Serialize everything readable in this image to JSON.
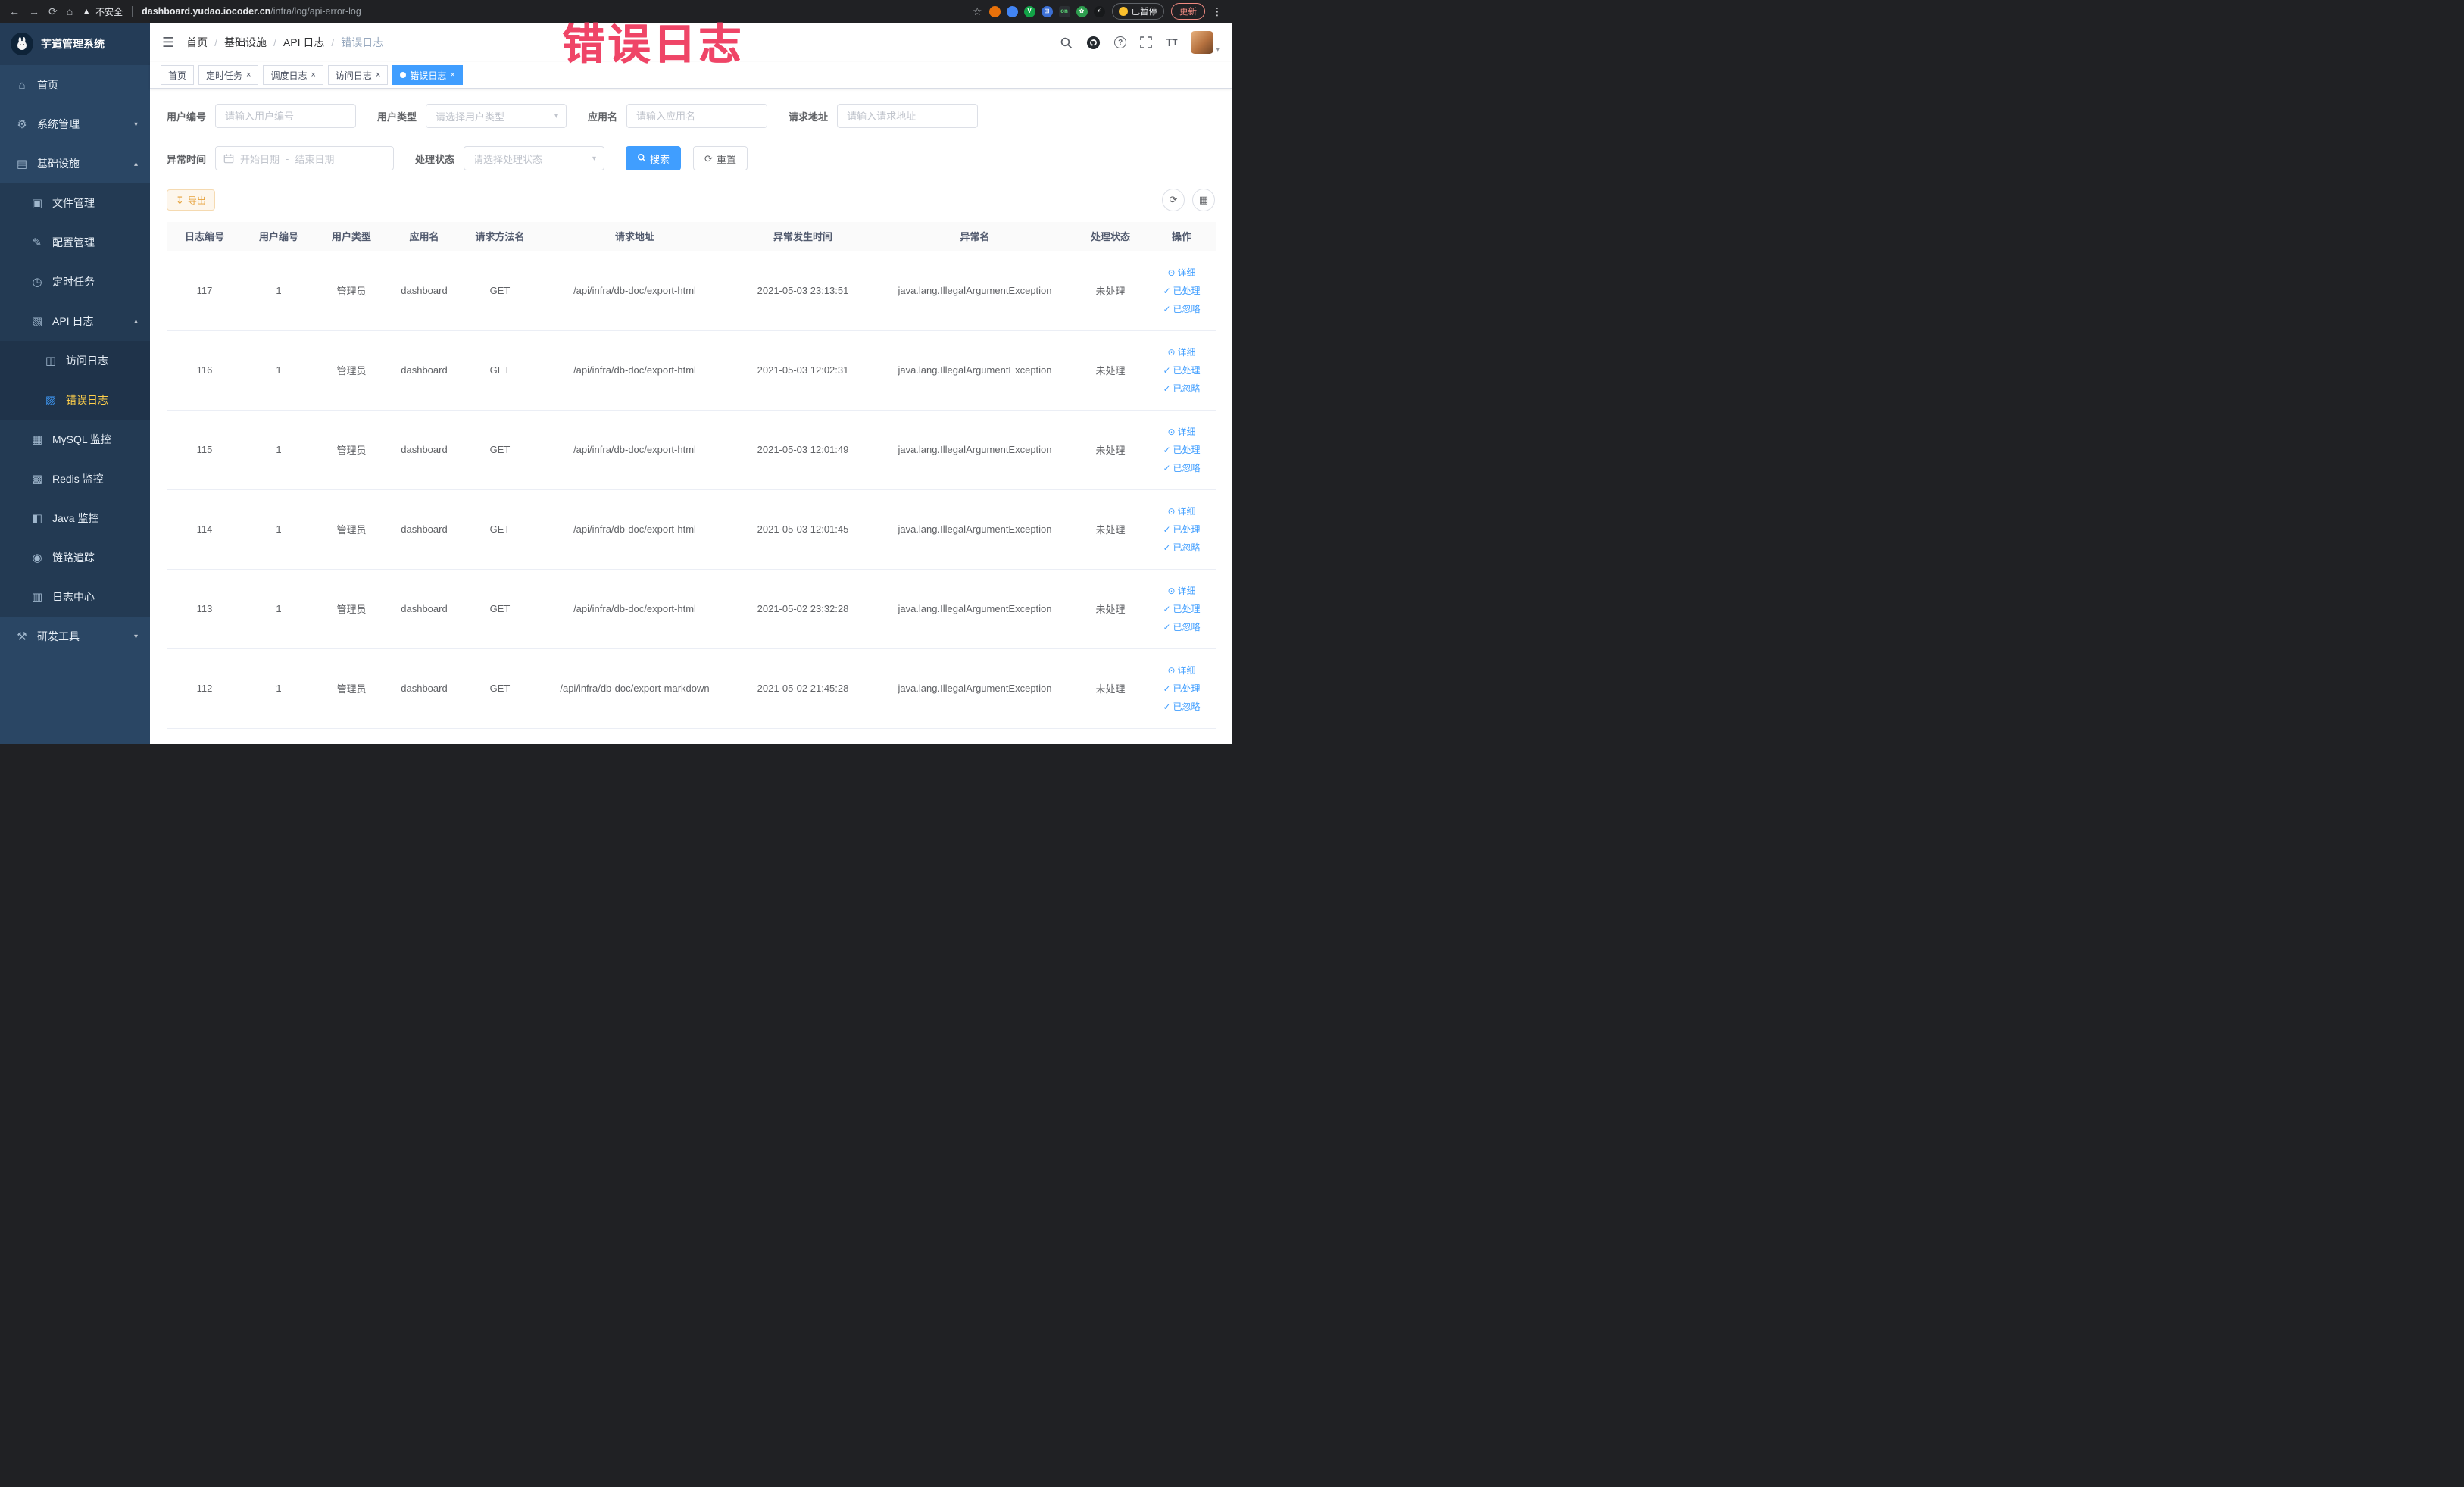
{
  "colors": {
    "accent": "#409eff",
    "sidebar_bg": "#2a4664",
    "menu_active_text": "#ffd04b",
    "annotation": "#ef4567",
    "warning": "#e6a23c",
    "tag_active_bg": "#409eff"
  },
  "annotation": {
    "text": "错误日志"
  },
  "browser": {
    "security_label": "不安全",
    "url_domain": "dashboard.yudao.iocoder.cn",
    "url_path": "/infra/log/api-error-log",
    "paused_badge": "已暂停",
    "update_button": "更新",
    "extensions": [
      {
        "name": "extension-red-icon",
        "bg": "#e8710a",
        "fg": "#ffffff",
        "glyph": "",
        "shape": "circle"
      },
      {
        "name": "extension-blue-dot-icon",
        "bg": "#4285f4",
        "fg": "#ffffff",
        "glyph": "",
        "shape": "circle"
      },
      {
        "name": "extension-green-v-icon",
        "bg": "#12a347",
        "fg": "#ffffff",
        "glyph": "V",
        "shape": "circle"
      },
      {
        "name": "extension-grid-icon",
        "bg": "#3b6fd4",
        "fg": "#ffffff",
        "glyph": "⊞",
        "shape": "circle"
      },
      {
        "name": "extension-on-badge-icon",
        "bg": "#2b2f33",
        "fg": "#58d274",
        "glyph": "on",
        "shape": "square"
      },
      {
        "name": "extension-leaf-icon",
        "bg": "#2e9e4f",
        "fg": "#ffffff",
        "glyph": "✿",
        "shape": "circle"
      },
      {
        "name": "extension-plug-icon",
        "bg": "#17191b",
        "fg": "#ffffff",
        "glyph": "⚡",
        "shape": "circle"
      }
    ]
  },
  "icons": {
    "search-icon": "magnifier",
    "github-icon": "octocat-circle",
    "help-icon": "question-circle",
    "fullscreen-icon": "expand-corners",
    "font-size-icon": "text-size",
    "hamburger-icon": "menu-lines",
    "back-icon": "arrow-left",
    "forward-icon": "arrow-right",
    "refresh-icon": "reload",
    "home-icon": "house",
    "bookmark-star-icon": "star-outline",
    "warning-triangle-icon": "warning",
    "calendar-icon": "calendar",
    "eye-icon": "view-detail",
    "check-icon": "checkmark"
  },
  "sidebar": {
    "logo_title": "芋道管理系统",
    "menu": [
      {
        "key": "home",
        "label": "首页",
        "glyph": "⌂",
        "icon": "home-icon",
        "level": 1
      },
      {
        "key": "system-management",
        "label": "系统管理",
        "glyph": "⚙",
        "icon": "gear-icon",
        "level": 1,
        "arrow": "down"
      },
      {
        "key": "infrastructure",
        "label": "基础设施",
        "glyph": "▤",
        "icon": "infrastructure-icon",
        "level": 1,
        "arrow": "up"
      },
      {
        "key": "file-management",
        "label": "文件管理",
        "glyph": "▣",
        "icon": "file-icon",
        "level": 2
      },
      {
        "key": "config-management",
        "label": "配置管理",
        "glyph": "✎",
        "icon": "config-icon",
        "level": 2
      },
      {
        "key": "scheduled-jobs",
        "label": "定时任务",
        "glyph": "◷",
        "icon": "timer-icon",
        "level": 2
      },
      {
        "key": "api-log",
        "label": "API 日志",
        "glyph": "▧",
        "icon": "api-log-icon",
        "level": 2,
        "arrow": "up"
      },
      {
        "key": "access-log",
        "label": "访问日志",
        "glyph": "◫",
        "icon": "access-log-icon",
        "level": 3
      },
      {
        "key": "error-log",
        "label": "错误日志",
        "glyph": "▨",
        "icon": "error-log-icon",
        "level": 3,
        "active": true
      },
      {
        "key": "mysql-monitor",
        "label": "MySQL 监控",
        "glyph": "▦",
        "icon": "mysql-icon",
        "level": 2
      },
      {
        "key": "redis-monitor",
        "label": "Redis 监控",
        "glyph": "▩",
        "icon": "redis-icon",
        "level": 2
      },
      {
        "key": "java-monitor",
        "label": "Java 监控",
        "glyph": "◧",
        "icon": "java-icon",
        "level": 2
      },
      {
        "key": "link-trace",
        "label": "链路追踪",
        "glyph": "◉",
        "icon": "trace-icon",
        "level": 2
      },
      {
        "key": "log-center",
        "label": "日志中心",
        "glyph": "▥",
        "icon": "log-center-icon",
        "level": 2
      },
      {
        "key": "dev-tools",
        "label": "研发工具",
        "glyph": "⚒",
        "icon": "devtools-icon",
        "level": 1,
        "arrow": "down"
      }
    ]
  },
  "breadcrumb": {
    "items": [
      "首页",
      "基础设施",
      "API 日志",
      "错误日志"
    ]
  },
  "tabs": [
    {
      "label": "首页",
      "closable": false,
      "active": false
    },
    {
      "label": "定时任务",
      "closable": true,
      "active": false
    },
    {
      "label": "调度日志",
      "closable": true,
      "active": false
    },
    {
      "label": "访问日志",
      "closable": true,
      "active": false
    },
    {
      "label": "错误日志",
      "closable": true,
      "active": true
    }
  ],
  "filters": {
    "user_id": {
      "label": "用户编号",
      "placeholder": "请输入用户编号"
    },
    "user_type": {
      "label": "用户类型",
      "placeholder": "请选择用户类型"
    },
    "app_name": {
      "label": "应用名",
      "placeholder": "请输入应用名"
    },
    "request_url": {
      "label": "请求地址",
      "placeholder": "请输入请求地址"
    },
    "exception_time": {
      "label": "异常时间",
      "start_placeholder": "开始日期",
      "separator": "-",
      "end_placeholder": "结束日期"
    },
    "process_status": {
      "label": "处理状态",
      "placeholder": "请选择处理状态"
    },
    "search_button": "搜索",
    "reset_button": "重置"
  },
  "toolbar": {
    "export_button": "导出"
  },
  "table": {
    "columns": [
      {
        "key": "log_id",
        "label": "日志编号"
      },
      {
        "key": "user_id",
        "label": "用户编号"
      },
      {
        "key": "user_type",
        "label": "用户类型"
      },
      {
        "key": "app_name",
        "label": "应用名"
      },
      {
        "key": "method",
        "label": "请求方法名"
      },
      {
        "key": "request_url",
        "label": "请求地址"
      },
      {
        "key": "time",
        "label": "异常发生时间"
      },
      {
        "key": "exception",
        "label": "异常名"
      },
      {
        "key": "status",
        "label": "处理状态"
      },
      {
        "key": "actions",
        "label": "操作"
      }
    ],
    "rows": [
      {
        "log_id": "117",
        "user_id": "1",
        "user_type": "管理员",
        "app_name": "dashboard",
        "method": "GET",
        "request_url": "/api/infra/db-doc/export-html",
        "time": "2021-05-03 23:13:51",
        "exception": "java.lang.IllegalArgumentException",
        "status": "未处理"
      },
      {
        "log_id": "116",
        "user_id": "1",
        "user_type": "管理员",
        "app_name": "dashboard",
        "method": "GET",
        "request_url": "/api/infra/db-doc/export-html",
        "time": "2021-05-03 12:02:31",
        "exception": "java.lang.IllegalArgumentException",
        "status": "未处理"
      },
      {
        "log_id": "115",
        "user_id": "1",
        "user_type": "管理员",
        "app_name": "dashboard",
        "method": "GET",
        "request_url": "/api/infra/db-doc/export-html",
        "time": "2021-05-03 12:01:49",
        "exception": "java.lang.IllegalArgumentException",
        "status": "未处理"
      },
      {
        "log_id": "114",
        "user_id": "1",
        "user_type": "管理员",
        "app_name": "dashboard",
        "method": "GET",
        "request_url": "/api/infra/db-doc/export-html",
        "time": "2021-05-03 12:01:45",
        "exception": "java.lang.IllegalArgumentException",
        "status": "未处理"
      },
      {
        "log_id": "113",
        "user_id": "1",
        "user_type": "管理员",
        "app_name": "dashboard",
        "method": "GET",
        "request_url": "/api/infra/db-doc/export-html",
        "time": "2021-05-02 23:32:28",
        "exception": "java.lang.IllegalArgumentException",
        "status": "未处理"
      },
      {
        "log_id": "112",
        "user_id": "1",
        "user_type": "管理员",
        "app_name": "dashboard",
        "method": "GET",
        "request_url": "/api/infra/db-doc/export-markdown",
        "time": "2021-05-02 21:45:28",
        "exception": "java.lang.IllegalArgumentException",
        "status": "未处理"
      }
    ],
    "actions": {
      "detail": "详细",
      "processed": "已处理",
      "ignored": "已忽略"
    }
  }
}
